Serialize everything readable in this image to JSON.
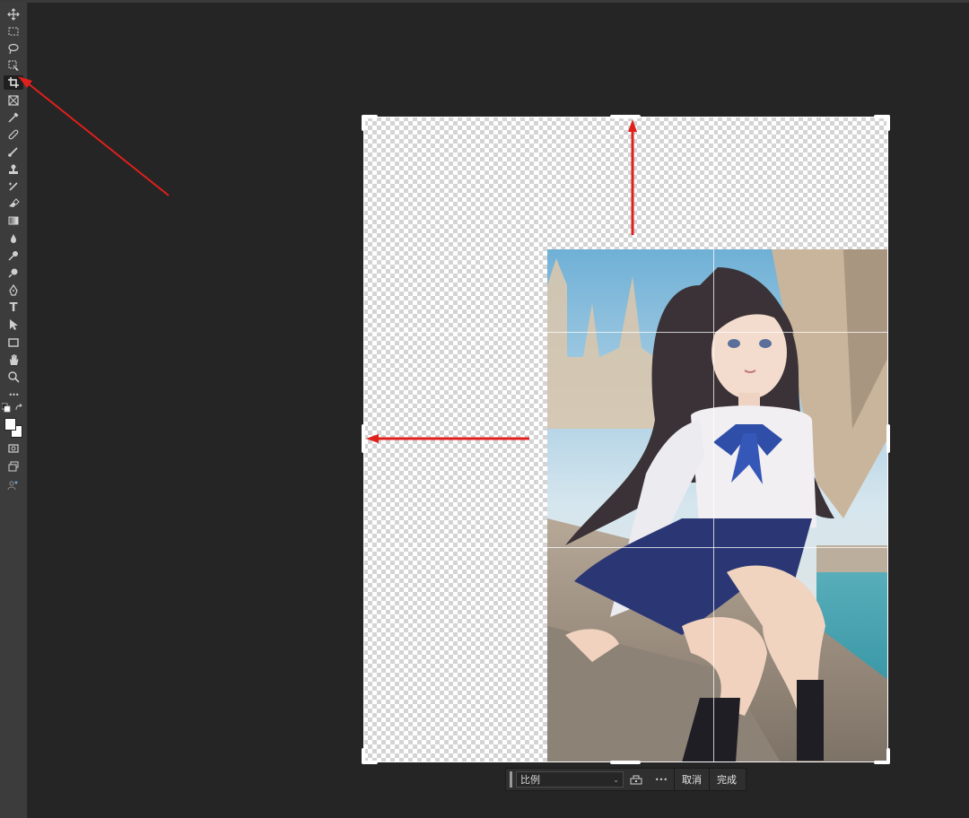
{
  "toolbar": {
    "tools": [
      {
        "name": "move-tool",
        "icon": "move-icon"
      },
      {
        "name": "marquee-tool",
        "icon": "marquee-icon"
      },
      {
        "name": "lasso-tool",
        "icon": "lasso-icon"
      },
      {
        "name": "object-select-tool",
        "icon": "object-select-icon"
      },
      {
        "name": "crop-tool",
        "icon": "crop-icon",
        "active": true
      },
      {
        "name": "frame-tool",
        "icon": "frame-icon"
      },
      {
        "name": "eyedropper-tool",
        "icon": "eyedropper-icon"
      },
      {
        "name": "healing-brush-tool",
        "icon": "bandage-icon"
      },
      {
        "name": "brush-tool",
        "icon": "brush-icon"
      },
      {
        "name": "stamp-tool",
        "icon": "stamp-icon"
      },
      {
        "name": "history-brush-tool",
        "icon": "history-brush-icon"
      },
      {
        "name": "eraser-tool",
        "icon": "eraser-icon"
      },
      {
        "name": "gradient-tool",
        "icon": "gradient-icon"
      },
      {
        "name": "blur-tool",
        "icon": "drop-icon"
      },
      {
        "name": "dodge-tool",
        "icon": "dodge-icon"
      },
      {
        "name": "pen-tool",
        "icon": "pen-icon"
      },
      {
        "name": "type-tool",
        "icon": "type-icon",
        "label": "T"
      },
      {
        "name": "path-select-tool",
        "icon": "arrow-icon"
      },
      {
        "name": "rectangle-tool",
        "icon": "rectangle-icon"
      },
      {
        "name": "hand-tool",
        "icon": "hand-icon"
      },
      {
        "name": "zoom-tool",
        "icon": "zoom-icon"
      },
      {
        "name": "more-tools",
        "icon": "ellipsis-icon",
        "label": "•••"
      }
    ]
  },
  "options_bar": {
    "ratio_label": "比例",
    "cancel_label": "取消",
    "done_label": "完成",
    "more_label": "•••"
  },
  "annotations": {
    "arrow_color": "#e0201c"
  },
  "colors": {
    "foreground": "#ffffff",
    "background": "#ffffff"
  }
}
